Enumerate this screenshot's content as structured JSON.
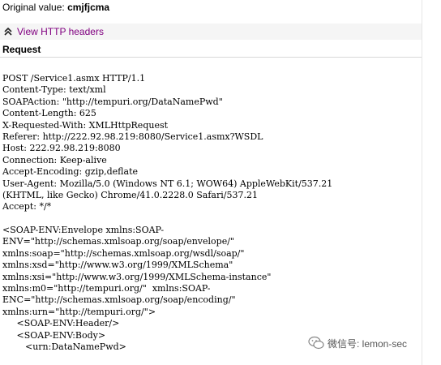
{
  "original": {
    "label": "Original value:",
    "value": "cmjfjcma"
  },
  "http_headers": {
    "toggle_label": "View HTTP headers",
    "icon": "double-chevron-up-icon"
  },
  "request": {
    "heading": "Request"
  },
  "body_lines": [
    "POST /Service1.asmx HTTP/1.1",
    "Content-Type: text/xml",
    "SOAPAction: \"http://tempuri.org/DataNamePwd\"",
    "Content-Length: 625",
    "X-Requested-With: XMLHttpRequest",
    "Referer: http://222.92.98.219:8080/Service1.asmx?WSDL",
    "Host: 222.92.98.219:8080",
    "Connection: Keep-alive",
    "Accept-Encoding: gzip,deflate",
    "User-Agent: Mozilla/5.0 (Windows NT 6.1; WOW64) AppleWebKit/537.21",
    "(KHTML, like Gecko) Chrome/41.0.2228.0 Safari/537.21",
    "Accept: */*",
    "",
    "<SOAP-ENV:Envelope xmlns:SOAP-",
    "ENV=\"http://schemas.xmlsoap.org/soap/envelope/\"",
    "xmlns:soap=\"http://schemas.xmlsoap.org/wsdl/soap/\"",
    "xmlns:xsd=\"http://www.w3.org/1999/XMLSchema\"",
    "xmlns:xsi=\"http://www.w3.org/1999/XMLSchema-instance\"",
    "xmlns:m0=\"http://tempuri.org/\"  xmlns:SOAP-",
    "ENC=\"http://schemas.xmlsoap.org/soap/encoding/\"",
    "xmlns:urn=\"http://tempuri.org/\">",
    "     <SOAP-ENV:Header/>",
    "     <SOAP-ENV:Body>",
    "        <urn:DataNamePwd>"
  ],
  "watermark": {
    "text": "微信号: lemon-sec",
    "icon": "wechat-icon"
  }
}
